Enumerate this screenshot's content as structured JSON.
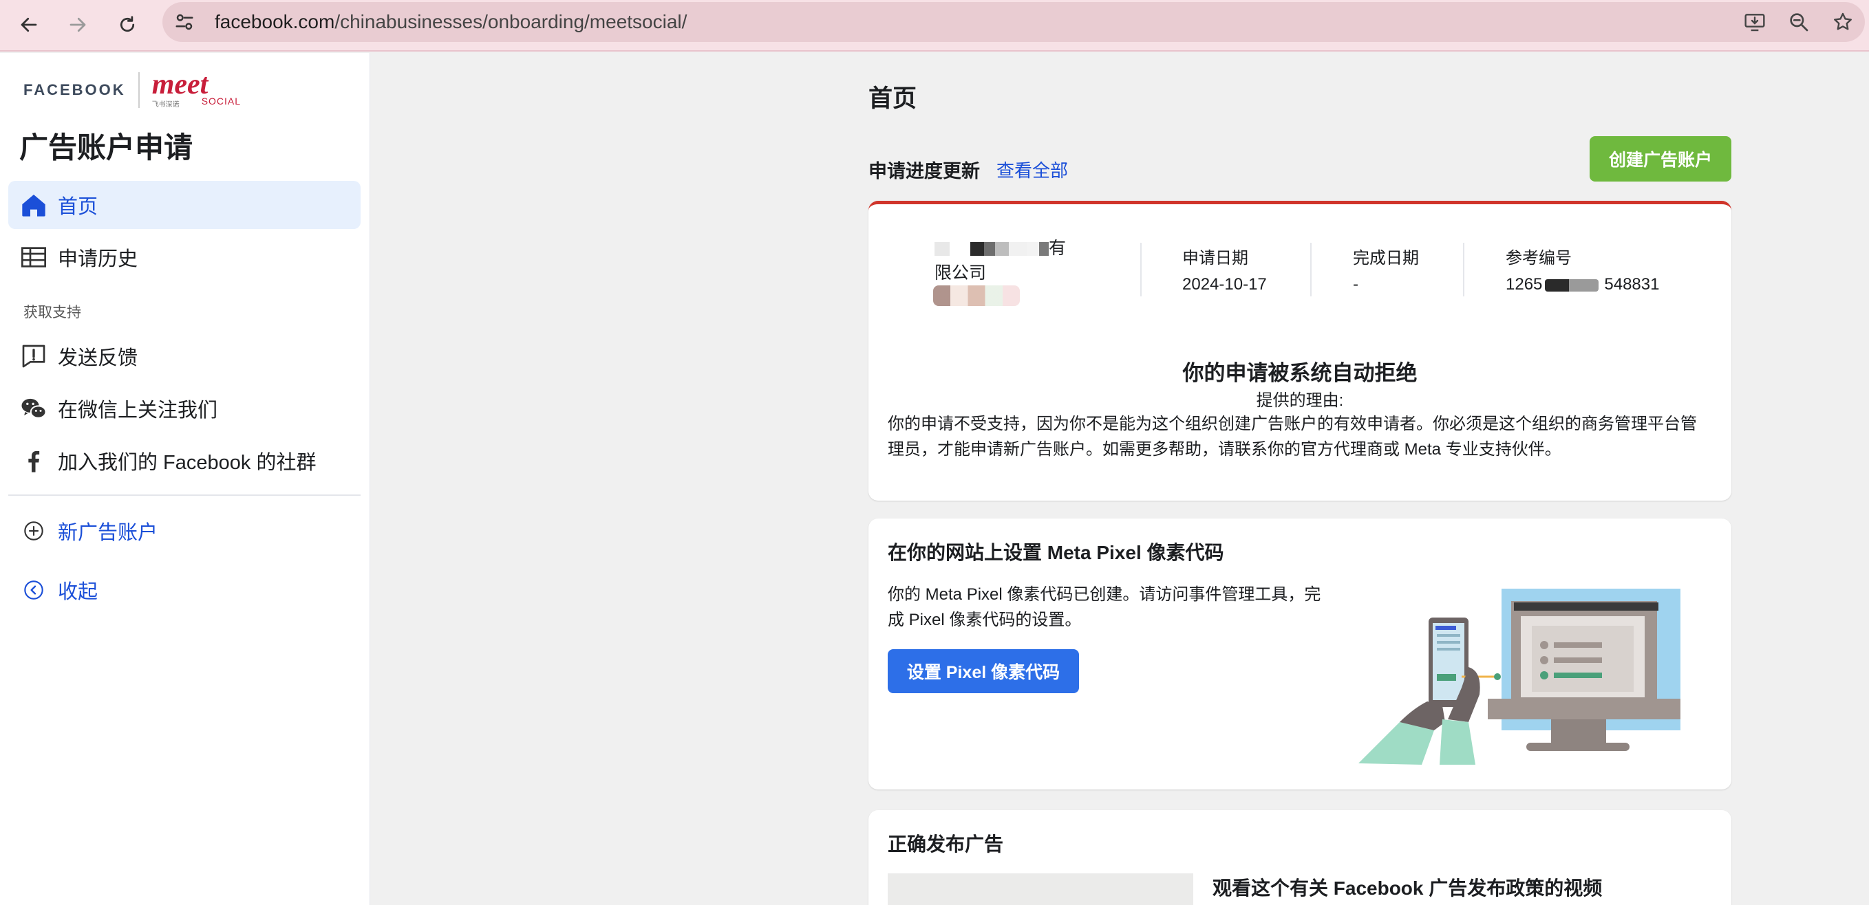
{
  "browser": {
    "url_domain": "facebook.com",
    "url_path": "/chinabusinesses/onboarding/meetsocial/"
  },
  "brand": {
    "facebook_wordmark": "FACEBOOK",
    "partner_wordmark": "meet",
    "partner_sub": "SOCIAL",
    "partner_cn": "飞书深诺"
  },
  "sidebar": {
    "title": "广告账户申请",
    "items": [
      {
        "label": "首页",
        "icon": "home-icon",
        "active": true
      },
      {
        "label": "申请历史",
        "icon": "table-icon",
        "active": false
      }
    ],
    "support_section": "获取支持",
    "support_items": [
      {
        "label": "发送反馈",
        "icon": "feedback-icon"
      },
      {
        "label": "在微信上关注我们",
        "icon": "wechat-icon"
      },
      {
        "label": "加入我们的 Facebook 的社群",
        "icon": "facebook-icon"
      }
    ],
    "new_account": "新广告账户",
    "collapse": "收起"
  },
  "main": {
    "page_title": "首页",
    "progress_title": "申请进度更新",
    "view_all": "查看全部",
    "create_button": "创建广告账户",
    "application": {
      "company_suffix_line1": "有",
      "company_line2": "限公司",
      "apply_date_label": "申请日期",
      "apply_date": "2024-10-17",
      "complete_date_label": "完成日期",
      "complete_date": "-",
      "ref_label": "参考编号",
      "ref_prefix": "1265",
      "ref_suffix": "548831",
      "status_title": "你的申请被系统自动拒绝",
      "reason_label": "提供的理由:",
      "reason_text": "你的申请不受支持，因为你不是能为这个组织创建广告账户的有效申请者。你必须是这个组织的商务管理平台管理员，才能申请新广告账户。如需更多帮助，请联系你的官方代理商或 Meta 专业支持伙伴。"
    },
    "pixel": {
      "heading": "在你的网站上设置 Meta Pixel 像素代码",
      "text": "你的 Meta Pixel 像素代码已创建。请访问事件管理工具，完成 Pixel 像素代码的设置。",
      "button": "设置 Pixel 像素代码"
    },
    "ads": {
      "heading": "正确发布广告",
      "video_title": "观看这个有关 Facebook 广告发布政策的视频"
    }
  },
  "colors": {
    "accent_blue": "#1b4fd8",
    "create_green": "#6fb93e",
    "reject_red": "#d0352b",
    "pixel_button": "#2d6fe8"
  }
}
